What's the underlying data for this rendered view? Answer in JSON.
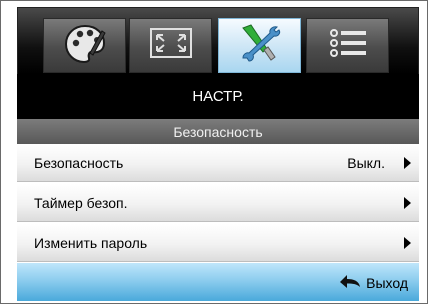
{
  "tabs": [
    {
      "name": "image-settings",
      "icon": "palette-icon",
      "active": false
    },
    {
      "name": "display",
      "icon": "screen-resize-icon",
      "active": false
    },
    {
      "name": "setup",
      "icon": "tools-icon",
      "active": true
    },
    {
      "name": "options",
      "icon": "list-icon",
      "active": false
    }
  ],
  "header": {
    "title": "НАСТР.",
    "subtitle": "Безопасность"
  },
  "menu": {
    "items": [
      {
        "label": "Безопасность",
        "value": "Выкл."
      },
      {
        "label": "Таймер безоп.",
        "value": ""
      },
      {
        "label": "Изменить пароль",
        "value": ""
      }
    ]
  },
  "footer": {
    "exit_label": "Выход"
  },
  "colors": {
    "accent_blue": "#4aa9db",
    "title_bg": "#000000",
    "subtitle_bg": "#6a6a6a"
  }
}
